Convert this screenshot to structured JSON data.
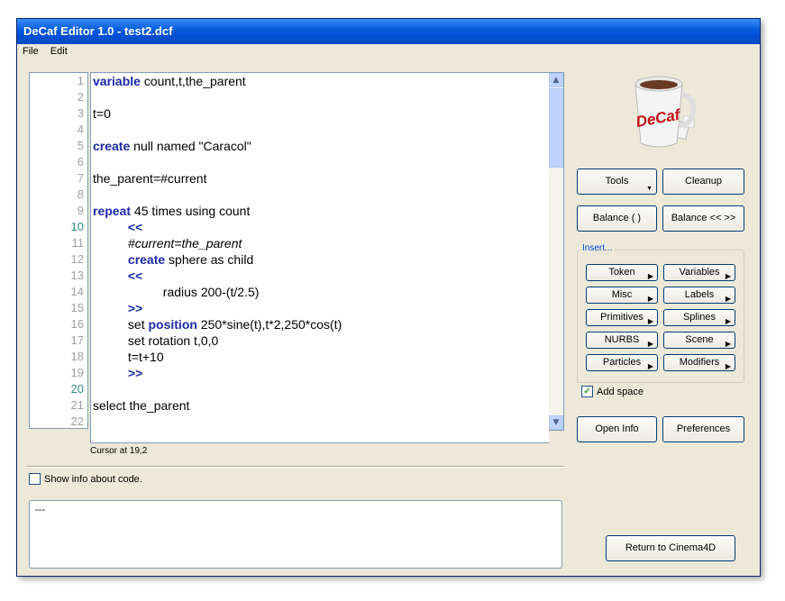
{
  "window": {
    "title": "DeCaf Editor 1.0 - test2.dcf"
  },
  "menu": [
    {
      "label": "File"
    },
    {
      "label": "Edit"
    }
  ],
  "editor": {
    "line_numbers": [
      "1",
      "2",
      "3",
      "4",
      "5",
      "6",
      "7",
      "8",
      "9",
      "10",
      "11",
      "12",
      "13",
      "14",
      "15",
      "16",
      "17",
      "18",
      "19",
      "20",
      "21",
      "22"
    ],
    "lines": [
      {
        "indent": "",
        "parts": [
          {
            "t": "variable",
            "k": "kw"
          },
          {
            "t": " count,t,the_parent"
          }
        ]
      },
      {
        "indent": "",
        "parts": []
      },
      {
        "indent": "",
        "parts": [
          {
            "t": "t=0"
          }
        ]
      },
      {
        "indent": "",
        "parts": []
      },
      {
        "indent": "",
        "parts": [
          {
            "t": "create",
            "k": "kw"
          },
          {
            "t": " null named \"Caracol\""
          }
        ]
      },
      {
        "indent": "",
        "parts": []
      },
      {
        "indent": "",
        "parts": [
          {
            "t": "the_parent=#current"
          }
        ]
      },
      {
        "indent": "",
        "parts": []
      },
      {
        "indent": "",
        "parts": [
          {
            "t": "repeat",
            "k": "kw"
          },
          {
            "t": " 45 times using count"
          }
        ]
      },
      {
        "indent": "          ",
        "parts": [
          {
            "t": "<<",
            "k": "kw"
          }
        ]
      },
      {
        "indent": "          ",
        "parts": [
          {
            "t": "#current=the_parent",
            "k": "it"
          }
        ]
      },
      {
        "indent": "          ",
        "parts": [
          {
            "t": "create",
            "k": "kw"
          },
          {
            "t": " sphere as child"
          }
        ]
      },
      {
        "indent": "          ",
        "parts": [
          {
            "t": "<<",
            "k": "kw"
          }
        ]
      },
      {
        "indent": "                    ",
        "parts": [
          {
            "t": "radius 200-(t/2.5)"
          }
        ]
      },
      {
        "indent": "          ",
        "parts": [
          {
            "t": ">>",
            "k": "kw"
          }
        ]
      },
      {
        "indent": "          ",
        "parts": [
          {
            "t": "set "
          },
          {
            "t": "position",
            "k": "kw"
          },
          {
            "t": " 250*sine(t),t*2,250*cos(t)"
          }
        ]
      },
      {
        "indent": "          ",
        "parts": [
          {
            "t": "set rotation t,0,0"
          }
        ]
      },
      {
        "indent": "          ",
        "parts": [
          {
            "t": "t=t+10"
          }
        ]
      },
      {
        "indent": "          ",
        "parts": [
          {
            "t": ">>",
            "k": "kw"
          }
        ]
      },
      {
        "indent": "",
        "parts": []
      },
      {
        "indent": "",
        "parts": [
          {
            "t": "select the_parent"
          }
        ]
      }
    ],
    "cursor_status": "Cursor at 19,2"
  },
  "show_info": {
    "label": "Show info about code.",
    "checked": false
  },
  "info_text": "---",
  "buttons": {
    "tools": "Tools",
    "cleanup": "Cleanup",
    "balance_paren": "Balance ( )",
    "balance_angle": "Balance << >>",
    "open_info": "Open Info",
    "preferences": "Preferences",
    "return": "Return to Cinema4D"
  },
  "insert": {
    "title": "Insert...",
    "items": [
      "Token",
      "Variables",
      "Misc",
      "Labels",
      "Primitives",
      "Splines",
      "NURBS",
      "Scene",
      "Particles",
      "Modifiers"
    ]
  },
  "add_space": {
    "label": "Add space",
    "checked": true
  },
  "logo": {
    "text": "DeCaf",
    "icon": "coffee-mug-logo"
  },
  "colors": {
    "keyword": "#1e2aa8",
    "titlebar": "#0a5fde",
    "linenum_highlight": "#2a8a8a"
  }
}
